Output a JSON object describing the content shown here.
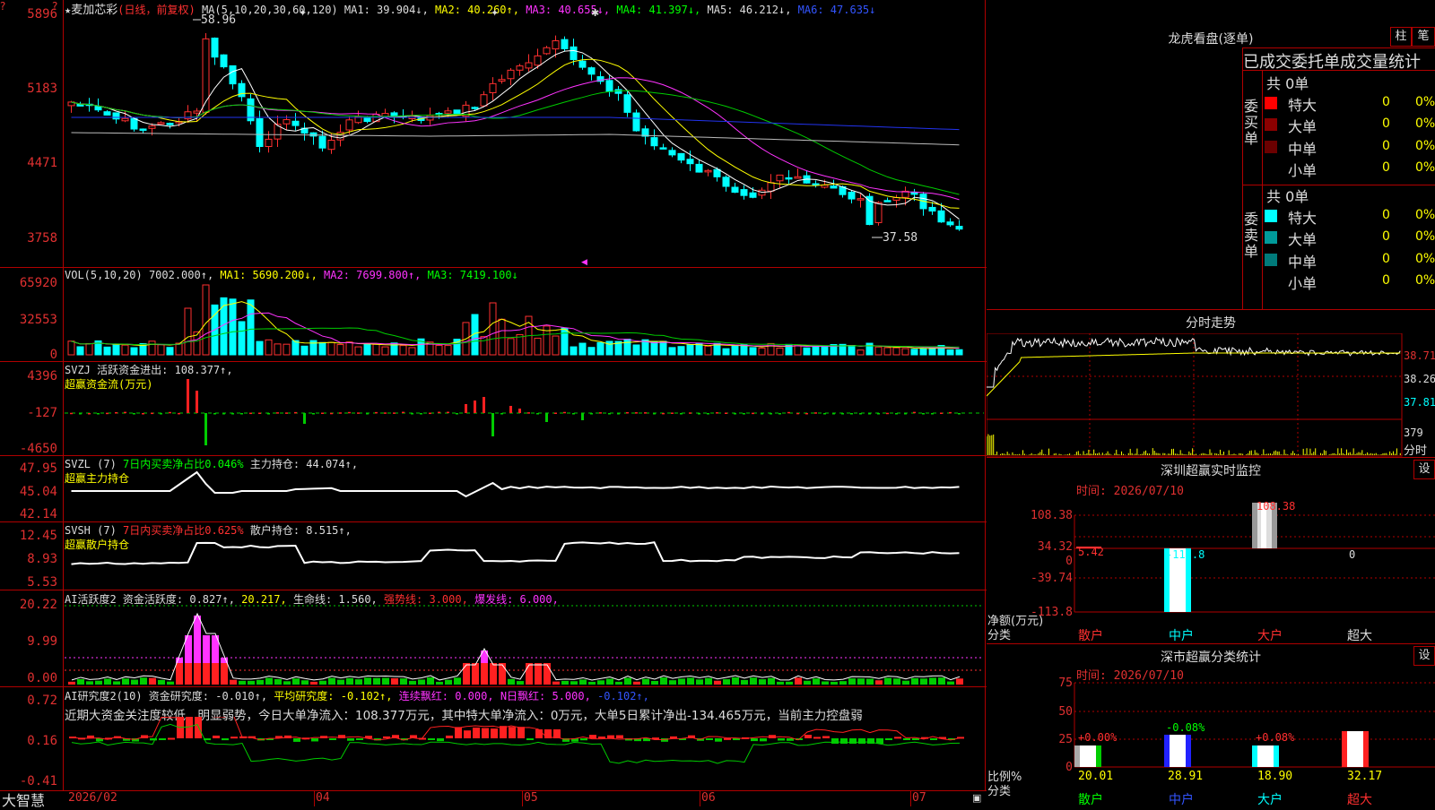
{
  "main": {
    "star": "★",
    "stock_name": "麦加芯彩",
    "mode": "(日线，前复权)",
    "ma_label": "MA(5,10,20,30,60,120)",
    "ma1": "MA1: 39.904↓,",
    "ma2": "MA2: 40.260↑,",
    "ma3": "MA3: 40.655↓,",
    "ma4": "MA4: 41.397↓,",
    "ma5": "MA5: 46.212↓,",
    "ma6": "MA6: 47.635↓",
    "high_mark": "58.96",
    "low_mark": "37.58",
    "y_ticks": [
      "5896",
      "5183",
      "4471",
      "3758"
    ]
  },
  "vol": {
    "label": "VOL(5,10,20)",
    "value": "7002.000↑,",
    "ma1": "MA1: 5690.200↓,",
    "ma2": "MA2: 7699.800↑,",
    "ma3": "MA3: 7419.100↓",
    "y_ticks": [
      "65920",
      "32553",
      "0"
    ]
  },
  "svzj": {
    "line1": "SVZJ  活跃资金进出: 108.377↑,",
    "line2": "超赢资金流(万元)",
    "y_ticks": [
      "4396",
      "-127",
      "-4650"
    ]
  },
  "svzl": {
    "prefix": "SVZL  (7)",
    "green_text": "7日内买卖净占比0.046%",
    "rest": " 主力持仓: 44.074↑,",
    "line2": "超赢主力持仓",
    "y_ticks": [
      "47.95",
      "45.04",
      "42.14"
    ]
  },
  "svsh": {
    "prefix": "SVSH  (7)",
    "red_text": "7日内买卖净占比0.625%",
    "rest": " 散户持仓: 8.515↑,",
    "line2": "超赢散户持仓",
    "y_ticks": [
      "12.45",
      "8.93",
      "5.53"
    ]
  },
  "ai1": {
    "a": "AI活跃度2 资金活跃度: 0.827↑,",
    "b": "20.217,",
    "c": "生命线: 1.560,",
    "d": "强势线: 3.000,",
    "e": "爆发线: 6.000,",
    "y_ticks": [
      "20.22",
      "9.99",
      "0.00"
    ]
  },
  "ai2": {
    "a": "AI研究度2(10) 资金研究度: -0.010↑,",
    "b": "平均研究度: -0.102↑,",
    "c": "连续飘红: 0.000,",
    "d": "N日飘红: 5.000,",
    "e": "-0.102↑,",
    "comment": "近期大资金关注度较低，明显弱势，今日大单净流入：108.377万元，其中特大单净流入：0万元，大单5日累计净出-134.465万元，当前主力控盘弱",
    "y_ticks": [
      "0.72",
      "0.16",
      "-0.41"
    ]
  },
  "bottom": {
    "brand": "大智慧",
    "dates": [
      "2026/02",
      "04",
      "05",
      "06",
      "07"
    ]
  },
  "right": {
    "lhb_title": "龙虎看盘(逐单)",
    "btn_zhu": "柱",
    "btn_bi": "笔",
    "stats_title": "已成交委托单成交量统计",
    "buy_side": "委买单",
    "sell_side": "委卖单",
    "buy_total": "共 0单",
    "sell_total": "共 0单",
    "sizes": [
      "特大",
      "大单",
      "中单",
      "小单"
    ],
    "counts": [
      "0",
      "0",
      "0",
      "0"
    ],
    "pcts": [
      "0%",
      "0%",
      "0%",
      "0%"
    ],
    "buy_colors": [
      "#ff0000",
      "#8b0000",
      "#6b0000",
      "#000000"
    ],
    "sell_colors": [
      "#00ffff",
      "#009a9a",
      "#007a7a",
      "#000000"
    ],
    "minute_title": "分时走势",
    "minute_prices": [
      "38.71",
      "38.26",
      "37.81"
    ],
    "minute_vol": "379",
    "minute_unit": "分时",
    "monitor_title": "深圳超赢实时监控",
    "monitor_btn": "设",
    "monitor_time": "时间: 2026/07/10",
    "monitor_y": [
      "108.38",
      "34.32",
      "0",
      "-39.74",
      "-113.8"
    ],
    "monitor_unit1": "净额(万元)",
    "monitor_unit2": "分类",
    "monitor_vals": [
      "5.42",
      "-113.8",
      "108.38",
      "0"
    ],
    "monitor_cats": [
      "散户",
      "中户",
      "大户",
      "超大"
    ],
    "class_title": "深市超赢分类统计",
    "class_btn": "设",
    "class_time": "时间: 2026/07/10",
    "class_y": [
      "75",
      "50",
      "25",
      "0"
    ],
    "class_pct_top": [
      "+0.00%",
      "-0.08%",
      "+0.08%",
      ""
    ],
    "class_vals": [
      "20.01",
      "28.91",
      "18.90",
      "32.17"
    ],
    "class_unit1": "比例%",
    "class_unit2": "分类",
    "class_cats": [
      "散户",
      "中户",
      "大户",
      "超大"
    ]
  }
}
